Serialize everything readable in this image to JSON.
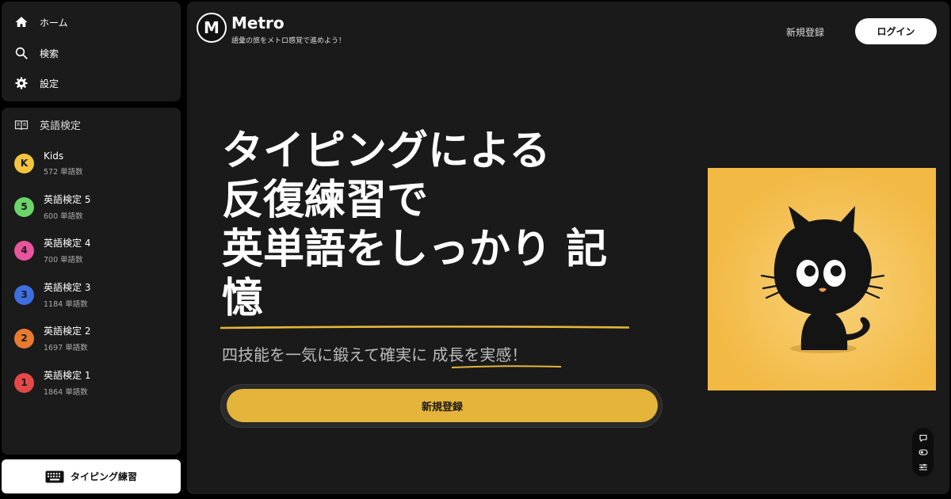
{
  "sidebar": {
    "nav": [
      {
        "label": "ホーム",
        "icon": "home-icon"
      },
      {
        "label": "検索",
        "icon": "search-icon"
      },
      {
        "label": "設定",
        "icon": "gear-icon"
      }
    ],
    "courses_title": "英語検定",
    "courses_icon": "book-icon",
    "courses": [
      {
        "badge": "K",
        "name": "Kids",
        "count": "572 単語数",
        "color": "#f3c53f"
      },
      {
        "badge": "5",
        "name": "英語検定 5",
        "count": "600 単語数",
        "color": "#6bd46a"
      },
      {
        "badge": "4",
        "name": "英語検定 4",
        "count": "700 単語数",
        "color": "#e9559c"
      },
      {
        "badge": "3",
        "name": "英語検定 3",
        "count": "1184 単語数",
        "color": "#3e6fe0"
      },
      {
        "badge": "2",
        "name": "英語検定 2",
        "count": "1697 単語数",
        "color": "#ea7a30"
      },
      {
        "badge": "1",
        "name": "英語検定 1",
        "count": "1864 単語数",
        "color": "#e54848"
      }
    ],
    "typing_button": "タイピング練習",
    "typing_icon": "keyboard-icon"
  },
  "header": {
    "logo_letter": "M",
    "brand": "Metro",
    "tagline": "語彙の旅をメトロ感覚で進めよう！",
    "signup_link": "新規登録",
    "login_button": "ログイン"
  },
  "hero": {
    "line1": "タイピングによる",
    "line2_highlight": "反復練習で",
    "line3": "英単語をしっかり 記",
    "line4": "憶",
    "subtitle_plain": "四技能を一気に鍛えて確実に ",
    "subtitle_underlined": "成長を実感！",
    "cta": "新規登録"
  },
  "colors": {
    "accent": "#e5b53b",
    "highlight": "#c9a43a",
    "illustration_bg": "#f2b944"
  },
  "tools": [
    "chat-icon",
    "toggle-icon",
    "sliders-icon"
  ]
}
